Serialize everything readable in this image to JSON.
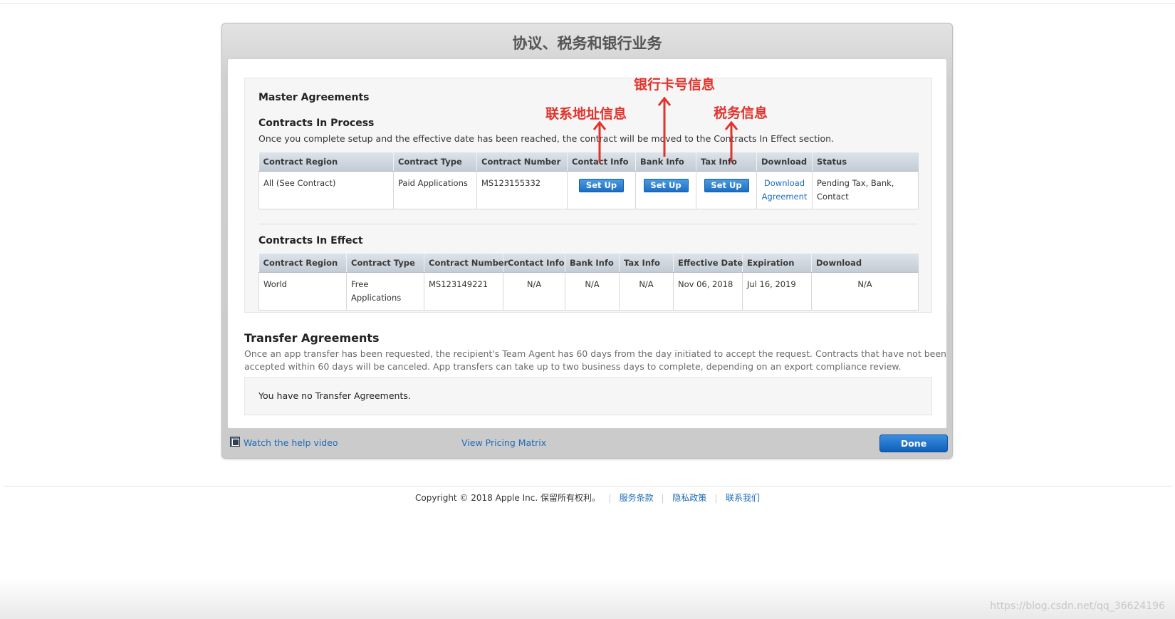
{
  "modal": {
    "title": "协议、税务和银行业务",
    "master": {
      "heading": "Master Agreements",
      "in_process": {
        "heading": "Contracts In Process",
        "description": "Once you complete setup and the effective date has been reached, the contract will be moved to the Contracts In Effect section.",
        "columns": [
          "Contract Region",
          "Contract Type",
          "Contract Number",
          "Contact Info",
          "Bank Info",
          "Tax Info",
          "Download",
          "Status"
        ],
        "row": {
          "region": "All (See Contract)",
          "type": "Paid Applications",
          "number": "MS123155332",
          "contact_btn": "Set Up",
          "bank_btn": "Set Up",
          "tax_btn": "Set Up",
          "download_line1": "Download",
          "download_line2": "Agreement",
          "status_line1": "Pending Tax, Bank,",
          "status_line2": "Contact"
        }
      },
      "in_effect": {
        "heading": "Contracts In Effect",
        "columns": [
          "Contract Region",
          "Contract Type",
          "Contract Number",
          "Contact Info",
          "Bank Info",
          "Tax Info",
          "Effective Date",
          "Expiration",
          "Download"
        ],
        "row": {
          "region": "World",
          "type": "Free Applications",
          "number": "MS123149221",
          "contact": "N/A",
          "bank": "N/A",
          "tax": "N/A",
          "effective": "Nov 06, 2018",
          "expiration": "Jul 16, 2019",
          "download": "N/A"
        }
      }
    },
    "transfer": {
      "heading": "Transfer Agreements",
      "description_line1": "Once an app transfer has been requested, the recipient's Team Agent has 60 days from the day initiated to accept the request. Contracts that have not been",
      "description_line2": "accepted within 60 days will be canceled. App transfers can take up to two business days to complete, depending on an export compliance review.",
      "empty_text": "You have no Transfer Agreements."
    },
    "footer": {
      "help_video": "Watch the help video",
      "pricing_matrix": "View Pricing Matrix",
      "done": "Done"
    }
  },
  "annotations": {
    "contact": "联系地址信息",
    "bank": "银行卡号信息",
    "tax": "税务信息",
    "color": "#e1322b"
  },
  "page_footer": {
    "copyright": "Copyright © 2018 Apple Inc. 保留所有权利。",
    "links": [
      "服务条款",
      "隐私政策",
      "联系我们"
    ]
  },
  "watermark": "https://blog.csdn.net/qq_36624196"
}
